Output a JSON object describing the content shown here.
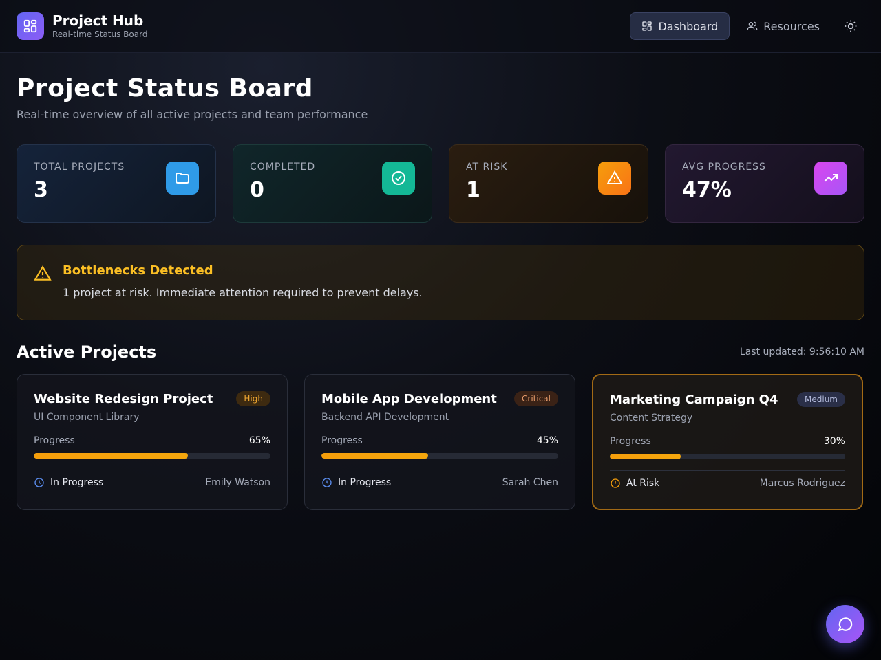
{
  "header": {
    "app_title": "Project Hub",
    "app_subtitle": "Real-time Status Board",
    "nav": [
      {
        "label": "Dashboard",
        "icon": "grid-icon",
        "active": true
      },
      {
        "label": "Resources",
        "icon": "users-icon",
        "active": false
      }
    ],
    "theme_icon": "sun-icon"
  },
  "page": {
    "title": "Project Status Board",
    "subtitle": "Real-time overview of all active projects and team performance"
  },
  "stats": [
    {
      "label": "TOTAL PROJECTS",
      "value": "3",
      "icon": "folder-icon",
      "color": "#2f9be8"
    },
    {
      "label": "COMPLETED",
      "value": "0",
      "icon": "check-circle-icon",
      "color": "#14b896"
    },
    {
      "label": "AT RISK",
      "value": "1",
      "icon": "warning-icon",
      "color": "#f59e0b"
    },
    {
      "label": "AVG PROGRESS",
      "value": "47%",
      "icon": "trending-up-icon",
      "color": "#c44ee0"
    }
  ],
  "alert": {
    "title": "Bottlenecks Detected",
    "message": "1 project at risk. Immediate attention required to prevent delays.",
    "color": "#fbbf24"
  },
  "projects_section": {
    "title": "Active Projects",
    "last_updated": "Last updated: 9:56:10 AM"
  },
  "projects": [
    {
      "title": "Website Redesign Project",
      "priority": "High",
      "task": "UI Component Library",
      "progress_label": "Progress",
      "progress": 65,
      "progress_text": "65%",
      "status": "In Progress",
      "owner": "Emily Watson"
    },
    {
      "title": "Mobile App Development",
      "priority": "Critical",
      "task": "Backend API Development",
      "progress_label": "Progress",
      "progress": 45,
      "progress_text": "45%",
      "status": "In Progress",
      "owner": "Sarah Chen"
    },
    {
      "title": "Marketing Campaign Q4",
      "priority": "Medium",
      "task": "Content Strategy",
      "progress_label": "Progress",
      "progress": 30,
      "progress_text": "30%",
      "status": "At Risk",
      "owner": "Marcus Rodriguez"
    }
  ],
  "colors": {
    "accent": "#6366f1",
    "warning": "#f59e0b",
    "status_blue": "#5b8def"
  }
}
